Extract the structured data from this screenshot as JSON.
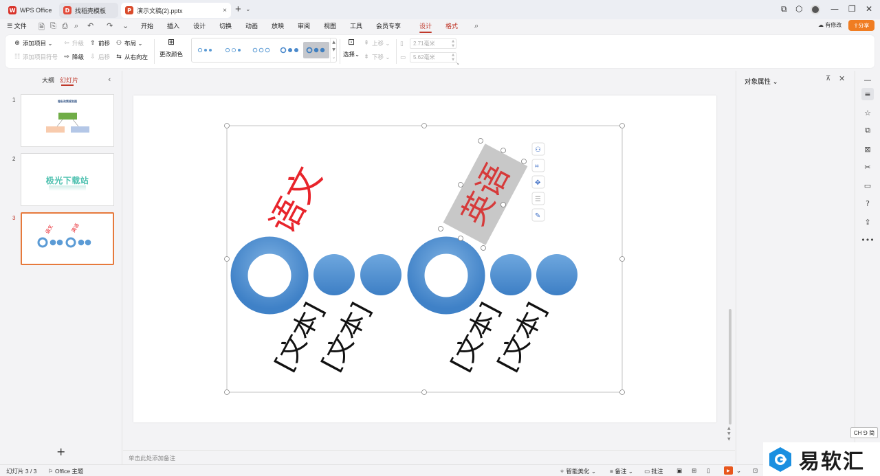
{
  "tabs": [
    {
      "label": "WPS Office",
      "logo": "W",
      "logo_color": "#d8322a"
    },
    {
      "label": "找稻壳模板",
      "logo": "D",
      "logo_color": "#e24b3b"
    },
    {
      "label": "演示文稿(2).pptx",
      "logo": "P",
      "logo_color": "#d94a2b",
      "close": "×"
    }
  ],
  "window": {
    "new_tab": "+",
    "minimize": "—",
    "restore": "❐",
    "close": "✕"
  },
  "menubar": {
    "file": "文件",
    "items": [
      "开始",
      "插入",
      "设计",
      "切换",
      "动画",
      "放映",
      "审阅",
      "视图",
      "工具",
      "会员专享",
      "设计",
      "格式"
    ],
    "active_index": 10,
    "has_edit": "有修改",
    "share": "分享"
  },
  "ribbon": {
    "add_item": "添加项目",
    "add_bullet": "添加项目符号",
    "promote": "升级",
    "demote": "降级",
    "forward": "前移",
    "backward": "后移",
    "layout": "布局",
    "rtl": "从右向左",
    "change_color": "更改颜色",
    "select": "选择",
    "move_up": "上移",
    "move_down": "下移",
    "width": "2.71毫米",
    "height": "5.62毫米"
  },
  "left_panel": {
    "outline_tab": "大纲",
    "slides_tab": "幻灯片",
    "slides": [
      {
        "num": "1",
        "title": "隐私政策规划图"
      },
      {
        "num": "2",
        "title": "极光下载站"
      },
      {
        "num": "3",
        "label_a": "语文",
        "label_b": "英语"
      }
    ],
    "add_slide": "+"
  },
  "slide": {
    "label_a": "语文",
    "label_b": "英语",
    "placeholder": "[文本]"
  },
  "notes_placeholder": "单击此处添加备注",
  "right_panel": {
    "title": "对象属性"
  },
  "ime": "CH ⅁ 简",
  "status": {
    "slide_counter": "幻灯片 3 / 3",
    "theme": "Office 主题",
    "beautify": "智能美化",
    "notes": "备注",
    "comments": "批注"
  },
  "watermark": {
    "text": "易软汇"
  },
  "colors": {
    "accent": "#c0392b",
    "smartart_blue": "#5b9bd5",
    "label_red": "#e8242b"
  }
}
